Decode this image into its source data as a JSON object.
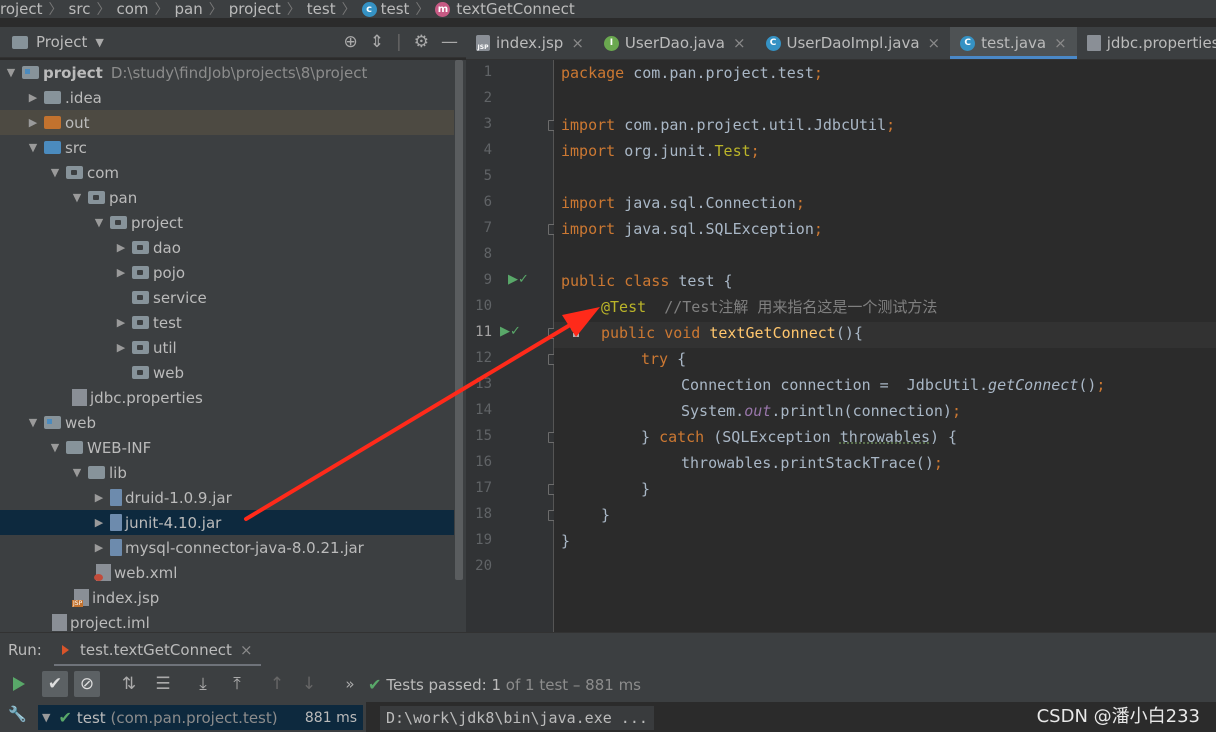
{
  "breadcrumb": {
    "items": [
      "roject",
      "src",
      "com",
      "pan",
      "project",
      "test",
      "test",
      "textGetConnect"
    ]
  },
  "project_panel": {
    "title": "Project",
    "tools": [
      "target-icon",
      "collapse-icon",
      "gear-icon",
      "minimize-icon"
    ],
    "tree": [
      {
        "label": "project",
        "path": "D:\\study\\findJob\\projects\\8\\project"
      },
      {
        "label": ".idea"
      },
      {
        "label": "out"
      },
      {
        "label": "src"
      },
      {
        "label": "com"
      },
      {
        "label": "pan"
      },
      {
        "label": "project"
      },
      {
        "label": "dao"
      },
      {
        "label": "pojo"
      },
      {
        "label": "service"
      },
      {
        "label": "test"
      },
      {
        "label": "util"
      },
      {
        "label": "web"
      },
      {
        "label": "jdbc.properties"
      },
      {
        "label": "web"
      },
      {
        "label": "WEB-INF"
      },
      {
        "label": "lib"
      },
      {
        "label": "druid-1.0.9.jar"
      },
      {
        "label": "junit-4.10.jar"
      },
      {
        "label": "mysql-connector-java-8.0.21.jar"
      },
      {
        "label": "web.xml"
      },
      {
        "label": "index.jsp"
      },
      {
        "label": "project.iml"
      }
    ]
  },
  "editor_tabs": [
    {
      "label": "index.jsp"
    },
    {
      "label": "UserDao.java"
    },
    {
      "label": "UserDaoImpl.java"
    },
    {
      "label": "test.java"
    },
    {
      "label": "jdbc.properties"
    }
  ],
  "line_numbers": [
    "1",
    "2",
    "3",
    "4",
    "5",
    "6",
    "7",
    "8",
    "9",
    "10",
    "11",
    "12",
    "13",
    "14",
    "15",
    "16",
    "17",
    "18",
    "19",
    "20"
  ],
  "code": {
    "l1_kw": "package",
    "l1_rest": " com.pan.project.test",
    "l1_semi": ";",
    "l3_kw": "import",
    "l3_rest": " com.pan.project.util.JdbcUtil",
    "l3_semi": ";",
    "l4_kw": "import",
    "l4_rest": " org.junit.",
    "l4_ann": "Test",
    "l4_semi": ";",
    "l6_kw": "import",
    "l6_rest": " java.sql.Connection",
    "l6_semi": ";",
    "l7_kw": "import",
    "l7_rest": " java.sql.SQLException",
    "l7_semi": ";",
    "l9_kw": "public class",
    "l9_rest": " test {",
    "l10_ann": "@Test",
    "l10_cmt": "  //Test注解 用来指名这是一个测试方法",
    "l11_kw": "public void",
    "l11_fn": " textGetConnect",
    "l11_rest": "(){",
    "l12_kw": "try",
    "l12_rest": " {",
    "l13_a": "Connection connection =  JdbcUtil.",
    "l13_fn": "getConnect",
    "l13_b": "()",
    "l13_semi": ";",
    "l14_a": "System.",
    "l14_st": "out",
    "l14_b": ".println(connection)",
    "l14_semi": ";",
    "l15_a": "} ",
    "l15_kw": "catch",
    "l15_b": " (SQLException ",
    "l15_und": "throwables",
    "l15_c": ") {",
    "l16_a": "throwables.printStackTrace()",
    "l16_semi": ";",
    "l17": "}",
    "l18": "}",
    "l19": "}"
  },
  "run_panel": {
    "label": "Run:",
    "tab": "test.textGetConnect",
    "tests_passed": "Tests passed:",
    "passed_count": "1",
    "of_text": "of 1 test – 881 ms",
    "test_row": "test",
    "test_row_pkg": "(com.pan.project.test)",
    "duration": "881 ms",
    "console": "D:\\work\\jdk8\\bin\\java.exe ...",
    "more": "»"
  },
  "watermark": "CSDN @潘小白233",
  "colors": {
    "keyword": "#cc7832",
    "annotation": "#bbb529",
    "comment": "#808080",
    "function": "#ffc66d",
    "selection": "#0d293e",
    "arrow": "#ff2a1a",
    "pass": "#59a869"
  }
}
